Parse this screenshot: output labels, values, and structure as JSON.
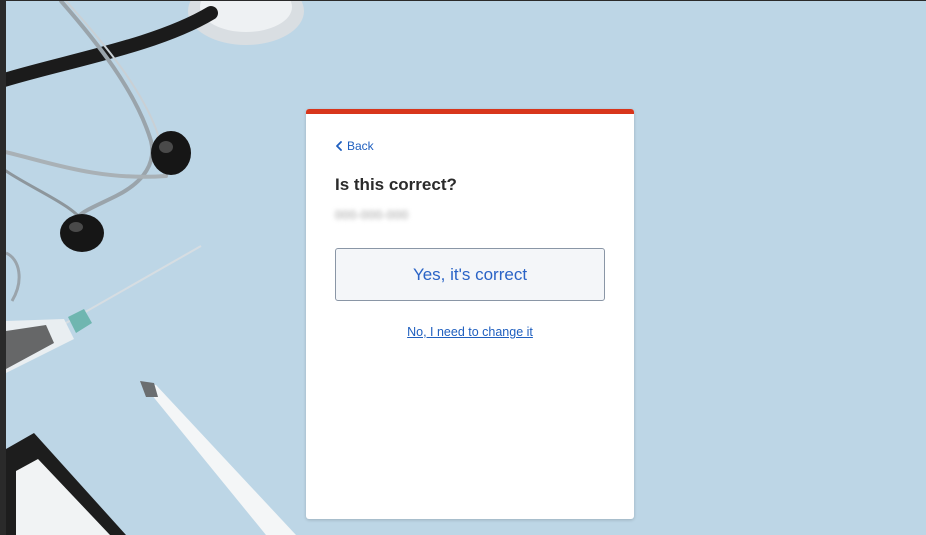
{
  "card": {
    "accent_color": "#d8361c",
    "back_label": "Back",
    "back_icon": "chevron-left-icon",
    "title": "Is this correct?",
    "blurred_value": "000-000-000",
    "yes_button_label": "Yes, it's correct",
    "no_link_label": "No, I need to change it"
  },
  "colors": {
    "background": "#bdd6e6",
    "link": "#1f5fbf",
    "button_text": "#2a63c6"
  }
}
